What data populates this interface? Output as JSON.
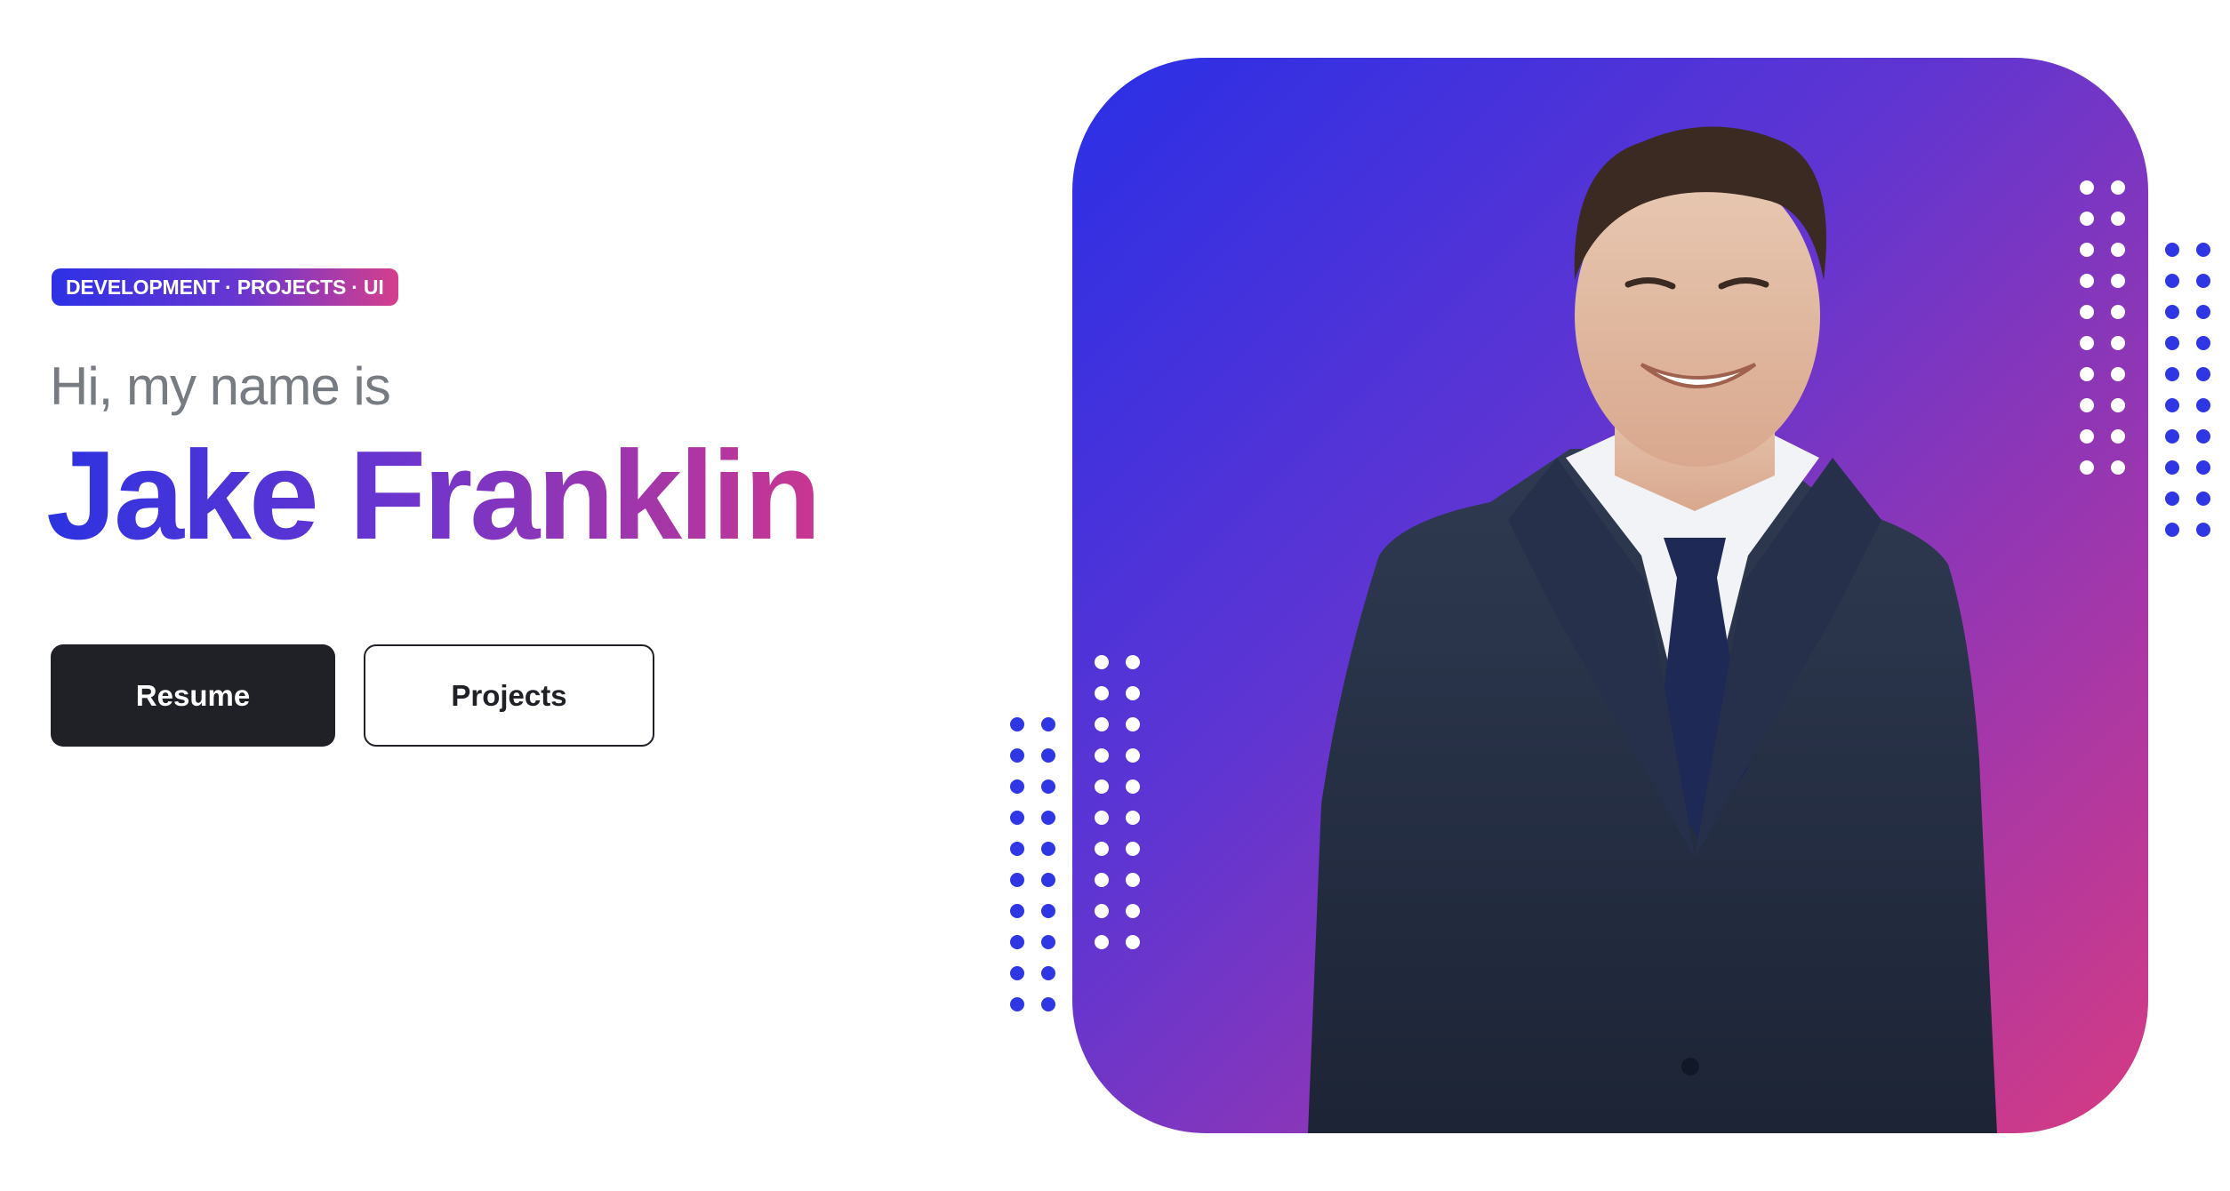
{
  "hero": {
    "tagline": "DEVELOPMENT · PROJECTS · UI",
    "greeting": "Hi, my name is",
    "name": "Jake Franklin"
  },
  "buttons": {
    "resume_label": "Resume",
    "projects_label": "Projects"
  },
  "colors": {
    "gradient_start": "#2a2fe6",
    "gradient_mid": "#6a36d0",
    "gradient_end": "#d63b82",
    "button_dark": "#1f2127",
    "greeting_gray": "#777b82",
    "dot_blue": "#2f36e4",
    "dot_white": "#ffffff"
  },
  "image": {
    "subject": "portrait-photo"
  }
}
